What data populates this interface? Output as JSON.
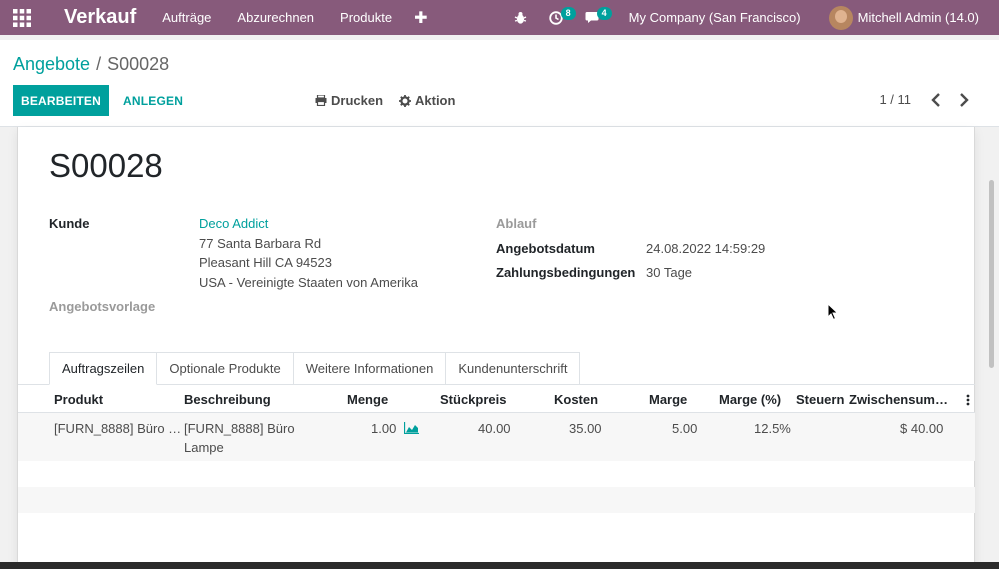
{
  "navbar": {
    "app_title": "Verkauf",
    "menu": [
      "Aufträge",
      "Abzurechnen",
      "Produkte"
    ],
    "plus": "✚",
    "activity_badge": "8",
    "messages_badge": "4",
    "company": "My Company (San Francisco)",
    "user": "Mitchell Admin (14.0)",
    "color": "#875a7b"
  },
  "control": {
    "breadcrumb_parent": "Angebote",
    "breadcrumb_sep": "/",
    "breadcrumb_current": "S00028",
    "edit_label": "BEARBEITEN",
    "create_label": "ANLEGEN",
    "print_label": "Drucken",
    "action_label": "Aktion",
    "pager": "1 / 11",
    "accent": "#00a09d"
  },
  "form": {
    "name": "S00028",
    "customer_label": "Kunde",
    "customer_name": "Deco Addict",
    "address_1": "77 Santa Barbara Rd",
    "address_2": "Pleasant Hill CA 94523",
    "address_3": "USA - Vereinigte Staaten von Amerika",
    "template_label": "Angebotsvorlage",
    "expiry_label": "Ablauf",
    "date_label": "Angebotsdatum",
    "date_value": "24.08.2022 14:59:29",
    "terms_label": "Zahlungsbedingungen",
    "terms_value": "30 Tage"
  },
  "tabs": [
    "Auftragszeilen",
    "Optionale Produkte",
    "Weitere Informationen",
    "Kundenunterschrift"
  ],
  "table": {
    "headers": [
      "Produkt",
      "Beschreibung",
      "Menge",
      "Stückpreis",
      "Kosten",
      "Marge",
      "Marge (%)",
      "Steuern",
      "Zwischensum…"
    ],
    "rows": [
      {
        "product": "[FURN_8888] Büro …",
        "description_1": "[FURN_8888] Büro",
        "description_2": "Lampe",
        "quantity": "1.00",
        "unit_price": "40.00",
        "cost": "35.00",
        "margin": "5.00",
        "margin_pct": "12.5%",
        "taxes": "",
        "subtotal": "$ 40.00"
      }
    ]
  }
}
